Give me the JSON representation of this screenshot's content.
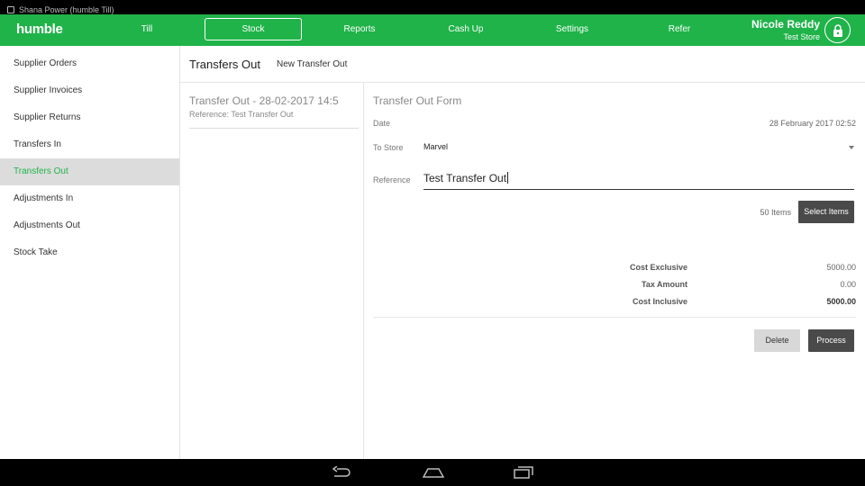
{
  "statusbar": {
    "title": "Shana Power (humble Till)"
  },
  "topnav": {
    "logo": "humble",
    "items": [
      {
        "label": "Till"
      },
      {
        "label": "Stock"
      },
      {
        "label": "Reports"
      },
      {
        "label": "Cash Up"
      },
      {
        "label": "Settings"
      },
      {
        "label": "Refer"
      }
    ],
    "active": "Stock",
    "user_name": "Nicole Reddy",
    "store_name": "Test Store",
    "lock_icon": "lock-icon"
  },
  "sidebar": {
    "items": [
      {
        "label": "Supplier Orders"
      },
      {
        "label": "Supplier Invoices"
      },
      {
        "label": "Supplier Returns"
      },
      {
        "label": "Transfers In"
      },
      {
        "label": "Transfers Out"
      },
      {
        "label": "Adjustments In"
      },
      {
        "label": "Adjustments Out"
      },
      {
        "label": "Stock Take"
      }
    ],
    "active": "Transfers Out"
  },
  "main": {
    "title": "Transfers Out",
    "new_button": "New Transfer Out",
    "list": [
      {
        "title": "Transfer Out - 28-02-2017 14:5",
        "reference": "Reference: Test Transfer Out"
      }
    ],
    "form": {
      "title": "Transfer Out Form",
      "date_label": "Date",
      "date_value": "28 February 2017 02:52",
      "store_label": "To Store",
      "store_value": "Marvel",
      "reference_label": "Reference",
      "reference_value": "Test Transfer Out",
      "items_count": "50 Items",
      "select_items_button": "Select Items",
      "totals": {
        "cost_exclusive_label": "Cost Exclusive",
        "cost_exclusive_value": "5000.00",
        "tax_label": "Tax Amount",
        "tax_value": "0.00",
        "cost_inclusive_label": "Cost Inclusive",
        "cost_inclusive_value": "5000.00"
      },
      "delete_button": "Delete",
      "process_button": "Process"
    }
  },
  "colors": {
    "accent": "#20b34a",
    "dark_button": "#4a4a4a"
  }
}
